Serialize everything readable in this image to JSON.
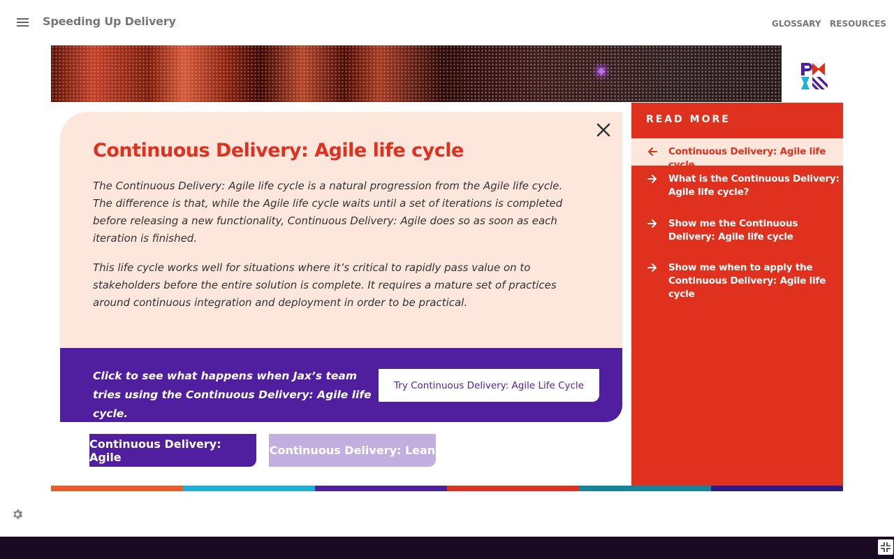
{
  "header": {
    "app_title": "Speeding Up Delivery",
    "nav": [
      "GLOSSARY",
      "RESOURCES"
    ]
  },
  "icons": {
    "menu": "hamburger-icon",
    "close": "close-icon",
    "settings": "gear-icon",
    "fullscreen": "exit-fullscreen-icon",
    "logo": "pmi-logo"
  },
  "panel": {
    "title": "Continuous Delivery: Agile life cycle",
    "paragraphs": [
      "The Continuous Delivery: Agile life cycle is a natural progression from the Agile life cycle. The difference is that, while the Agile life cycle waits until a set of iterations is completed before releasing a new functionality, Continuous Delivery: Agile does so as soon as each iteration is finished.",
      "This life cycle works well for situations where it’s critical to rapidly pass value on to stakeholders before the entire solution is complete. It requires a mature set of practices around continuous integration and deployment in order to be practical."
    ],
    "cta_text": "Click to see what happens when Jax’s team tries using the Continuous Delivery: Agile life cycle.",
    "cta_button": "Try Continuous Delivery: Agile Life Cycle"
  },
  "tabs": [
    {
      "label": "Continuous Delivery: Agile",
      "active": true,
      "color": "#4f1fa0"
    },
    {
      "label": "Continuous Delivery: Lean",
      "active": false,
      "color": "#c3aee0"
    }
  ],
  "sidebar": {
    "heading": "READ MORE",
    "items": [
      {
        "label": "Continuous Delivery: Agile life cycle",
        "icon": "arrow-left-icon",
        "active": true
      },
      {
        "label": "What is the Continuous Delivery: Agile life cycle?",
        "icon": "arrow-right-icon",
        "active": false
      },
      {
        "label": "Show me the Continuous Delivery: Agile life cycle",
        "icon": "arrow-right-icon",
        "active": false
      },
      {
        "label": "Show me when to apply the Continuous Delivery: Agile life cycle",
        "icon": "arrow-right-icon",
        "active": false
      }
    ]
  },
  "colors": {
    "accent_red": "#e0301e",
    "accent_purple": "#4f1fa0",
    "panel_bg": "#fde6dc",
    "stripes": [
      "#f05a28",
      "#1ab3d6",
      "#4f1fa0",
      "#e0301e",
      "#14869a",
      "#2e1a87"
    ]
  }
}
